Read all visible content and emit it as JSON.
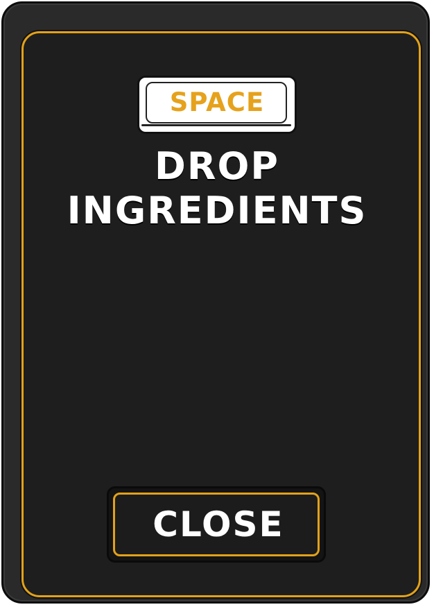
{
  "key_hint": {
    "key_label": "SPACE"
  },
  "action": {
    "line1": "DROP",
    "line2": "INGREDIENTS"
  },
  "close_button": {
    "label": "CLOSE"
  },
  "colors": {
    "accent": "#e2a21a",
    "panel": "#1e1e1e",
    "text": "#ffffff"
  }
}
